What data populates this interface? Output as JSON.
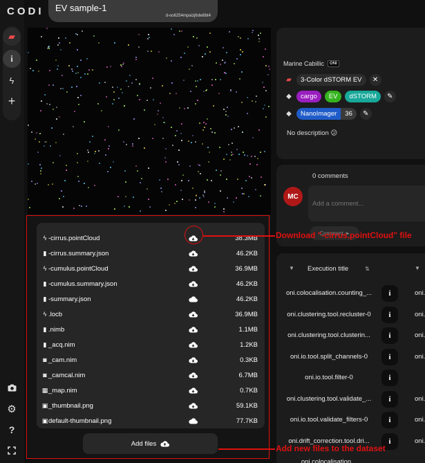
{
  "app": {
    "logo": "CODI"
  },
  "rail": {
    "items": [
      {
        "icon": "briefcase-icon",
        "glyph": "💼"
      },
      {
        "icon": "info-icon",
        "glyph": "ℹ"
      },
      {
        "icon": "lightning-icon",
        "glyph": "ϟ"
      },
      {
        "icon": "plus-icon",
        "glyph": "+"
      }
    ],
    "bottom_items": [
      {
        "icon": "camera-icon",
        "glyph": "📷"
      },
      {
        "icon": "gear-icon",
        "glyph": "⚙"
      },
      {
        "icon": "help-icon",
        "glyph": "?"
      },
      {
        "icon": "fullscreen-icon",
        "glyph": "⛶"
      }
    ]
  },
  "dataset": {
    "title": "EV sample-1",
    "id": "d-oo6254mpaizj6dw8bt4"
  },
  "info": {
    "owner": "Marine Cabillic",
    "owner_badge": "ONI",
    "project": "3-Color dSTORM EV",
    "tags": [
      {
        "label": "cargo",
        "color": "#9a1fbf"
      },
      {
        "label": "EV",
        "color": "#35b31e"
      },
      {
        "label": "dSTORM",
        "color": "#18a899"
      }
    ],
    "instrument_tag": "NanoImager",
    "instrument_count": "36",
    "description": "No description 😕"
  },
  "comments": {
    "title": "0 comments",
    "avatar": "MC",
    "placeholder": "Add a comment...",
    "submit": "Comment ➤"
  },
  "executions": {
    "header": "Execution title",
    "rows": [
      {
        "title": "oni.colocalisation.counting_...",
        "title2": "oni.colo"
      },
      {
        "title": "oni.clustering.tool.recluster-0",
        "title2": "oni.clus"
      },
      {
        "title": "oni.clustering.tool.clusterin...",
        "title2": "oni.clus"
      },
      {
        "title": "oni.io.tool.split_channels-0",
        "title2": "oni.i"
      },
      {
        "title": "oni.io.tool.filter-0",
        "title2": ""
      },
      {
        "title": "oni.clustering.tool.validate_...",
        "title2": "oni.clu"
      },
      {
        "title": "oni.io.tool.validate_filters-0",
        "title2": "oni.i"
      },
      {
        "title": "oni.drift_correction.tool.dri...",
        "title2": "oni.dri"
      },
      {
        "title": "oni.colocalisation...",
        "title2": ""
      }
    ]
  },
  "files": {
    "rows": [
      {
        "icon": "ϟ",
        "name": "-cirrus.pointCloud",
        "size": "38.3MB",
        "dl": "solid"
      },
      {
        "icon": "▮",
        "name": "-cirrus.summary.json",
        "size": "46.2KB",
        "dl": "solid"
      },
      {
        "icon": "ϟ",
        "name": "-cumulus.pointCloud",
        "size": "36.9MB",
        "dl": "solid"
      },
      {
        "icon": "▮",
        "name": "-cumulus.summary.json",
        "size": "46.2KB",
        "dl": "solid"
      },
      {
        "icon": "▮",
        "name": "-summary.json",
        "size": "46.2KB",
        "dl": "cloud"
      },
      {
        "icon": "ϟ",
        "name": ".locb",
        "size": "36.9MB",
        "dl": "solid"
      },
      {
        "icon": "▮",
        "name": ".nimb",
        "size": "1.1MB",
        "dl": "solid"
      },
      {
        "icon": "▮",
        "name": "_acq.nim",
        "size": "1.2KB",
        "dl": "solid"
      },
      {
        "icon": "◙",
        "name": "_cam.nim",
        "size": "0.3KB",
        "dl": "solid"
      },
      {
        "icon": "◙",
        "name": "_camcal.nim",
        "size": "6.7MB",
        "dl": "solid"
      },
      {
        "icon": "▦",
        "name": "_map.nim",
        "size": "0.7KB",
        "dl": "solid"
      },
      {
        "icon": "▣",
        "name": "_thumbnail.png",
        "size": "59.1KB",
        "dl": "solid"
      },
      {
        "icon": "▣",
        "name": "default-thumbnail.png",
        "size": "77.7KB",
        "dl": "cloud"
      }
    ],
    "add_label": "Add files"
  },
  "annotations": {
    "download": "Download \"-cirrus.pointCloud\" file",
    "add": "Add new files to the dataset",
    "color": "#e01010"
  }
}
